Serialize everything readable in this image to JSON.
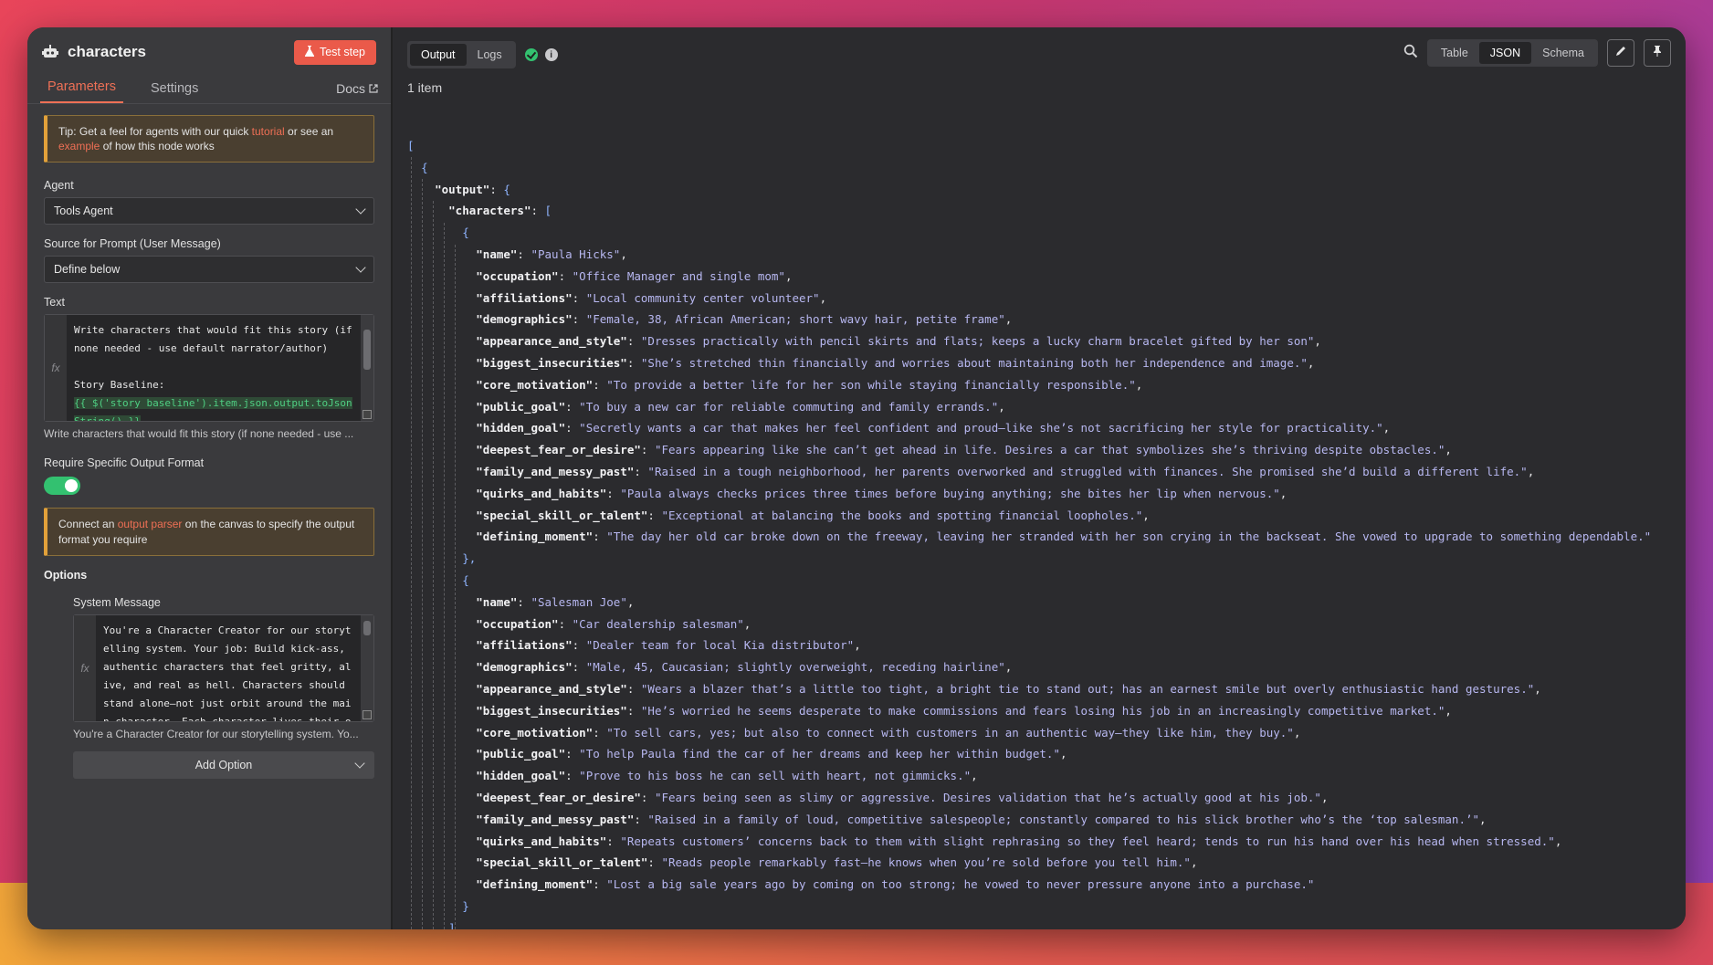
{
  "node": {
    "title": "characters",
    "test_step_label": "Test step",
    "tabs": [
      "Parameters",
      "Settings"
    ],
    "docs_label": "Docs"
  },
  "tip": {
    "prefix": "Tip: Get a feel for agents with our quick ",
    "link1": "tutorial",
    "middle": " or see an",
    "link2": "example",
    "suffix": " of how this node works"
  },
  "agent": {
    "label": "Agent",
    "value": "Tools Agent"
  },
  "source": {
    "label": "Source for Prompt (User Message)",
    "value": "Define below"
  },
  "text_field": {
    "label": "Text",
    "fx": "fx",
    "line1": "Write characters that would fit this story (if none needed - use default narrator/author)",
    "line2": "",
    "line3": "Story Baseline:",
    "expr": "{{ $('story baseline').item.json.output.toJsonString() }}",
    "preview": "Write characters that would fit this story (if none needed - use ..."
  },
  "output_format": {
    "label": "Require Specific Output Format",
    "enabled": true
  },
  "parser_tip": {
    "prefix": "Connect an ",
    "link": "output parser",
    "suffix": " on the canvas to specify the output format you require"
  },
  "options": {
    "title": "Options",
    "system_message_label": "System Message",
    "system_message": "You're a Character Creator for our storytelling system. Your job: Build kick-ass, authentic characters that feel gritty, alive, and real as hell. Characters should stand alone—not just orbit around the main character. Each character lives their own me",
    "system_preview": "You're a Character Creator for our storytelling system. Yo...",
    "add_option_label": "Add Option"
  },
  "output_panel": {
    "tabs": [
      "Output",
      "Logs"
    ],
    "views": [
      "Table",
      "JSON",
      "Schema"
    ],
    "active_view": "JSON",
    "item_count": "1 item",
    "info_icon": "i"
  },
  "json_output": {
    "characters": [
      {
        "name": "Paula Hicks",
        "occupation": "Office Manager and single mom",
        "affiliations": "Local community center volunteer",
        "demographics": "Female, 38, African American; short wavy hair, petite frame",
        "appearance_and_style": "Dresses practically with pencil skirts and flats; keeps a lucky charm bracelet gifted by her son",
        "biggest_insecurities": "She’s stretched thin financially and worries about maintaining both her independence and image.",
        "core_motivation": "To provide a better life for her son while staying financially responsible.",
        "public_goal": "To buy a new car for reliable commuting and family errands.",
        "hidden_goal": "Secretly wants a car that makes her feel confident and proud—like she’s not sacrificing her style for practicality.",
        "deepest_fear_or_desire": "Fears appearing like she can’t get ahead in life. Desires a car that symbolizes she’s thriving despite obstacles.",
        "family_and_messy_past": "Raised in a tough neighborhood, her parents overworked and struggled with finances. She promised she’d build a different life.",
        "quirks_and_habits": "Paula always checks prices three times before buying anything; she bites her lip when nervous.",
        "special_skill_or_talent": "Exceptional at balancing the books and spotting financial loopholes.",
        "defining_moment": "The day her old car broke down on the freeway, leaving her stranded with her son crying in the backseat. She vowed to upgrade to something dependable."
      },
      {
        "name": "Salesman Joe",
        "occupation": "Car dealership salesman",
        "affiliations": "Dealer team for local Kia distributor",
        "demographics": "Male, 45, Caucasian; slightly overweight, receding hairline",
        "appearance_and_style": "Wears a blazer that’s a little too tight, a bright tie to stand out; has an earnest smile but overly enthusiastic hand gestures.",
        "biggest_insecurities": "He’s worried he seems desperate to make commissions and fears losing his job in an increasingly competitive market.",
        "core_motivation": "To sell cars, yes; but also to connect with customers in an authentic way—they like him, they buy.",
        "public_goal": "To help Paula find the car of her dreams and keep her within budget.",
        "hidden_goal": "Prove to his boss he can sell with heart, not gimmicks.",
        "deepest_fear_or_desire": "Fears being seen as slimy or aggressive. Desires validation that he’s actually good at his job.",
        "family_and_messy_past": "Raised in a family of loud, competitive salespeople; constantly compared to his slick brother who’s the ‘top salesman.’",
        "quirks_and_habits": "Repeats customers’ concerns back to them with slight rephrasing so they feel heard; tends to run his hand over his head when stressed.",
        "special_skill_or_talent": "Reads people remarkably fast—he knows when you’re sold before you tell him.",
        "defining_moment": "Lost a big sale years ago by coming on too strong; he vowed to never pressure anyone into a purchase."
      }
    ]
  },
  "colors": {
    "accent": "#ee7056",
    "success": "#33c170",
    "json_value": "#b7b7f0"
  }
}
